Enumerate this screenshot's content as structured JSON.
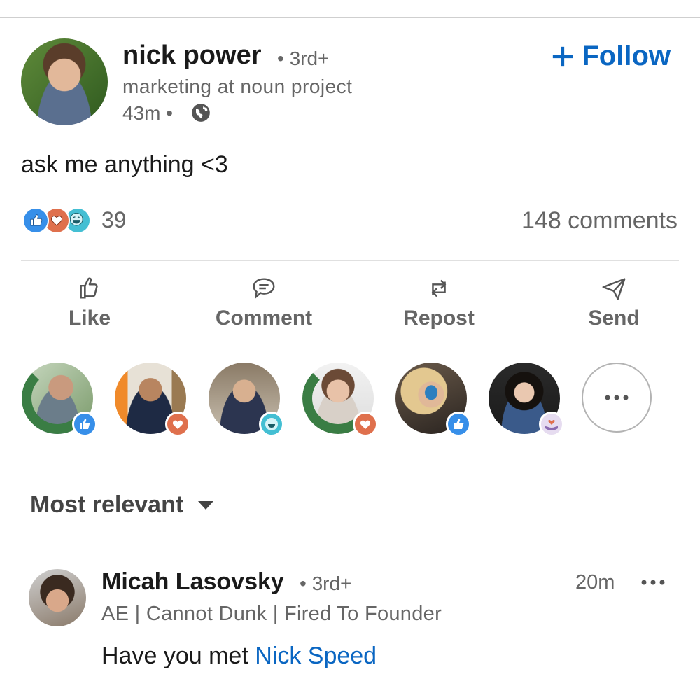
{
  "post": {
    "author_name": "nick power",
    "author_degree": "• 3rd+",
    "author_headline": "marketing at noun project",
    "time": "43m •",
    "follow_label": "Follow",
    "text": "ask me anything <3"
  },
  "social": {
    "reaction_count": "39",
    "comment_count": "148 comments",
    "reaction_icons": [
      "like-icon",
      "love-icon",
      "funny-icon"
    ]
  },
  "actions": {
    "like": "Like",
    "comment": "Comment",
    "repost": "Repost",
    "send": "Send"
  },
  "reactors": [
    {
      "badge": "like-icon",
      "frame": "#OPENTOWORK"
    },
    {
      "badge": "love-icon"
    },
    {
      "badge": "funny-icon"
    },
    {
      "badge": "love-icon",
      "frame": "#OPENTOWORK"
    },
    {
      "badge": "like-icon"
    },
    {
      "badge": "support-icon"
    }
  ],
  "sort": {
    "label": "Most relevant"
  },
  "comment": {
    "name": "Micah Lasovsky",
    "degree": "• 3rd+",
    "time": "20m",
    "headline": "AE | Cannot Dunk | Fired To Founder",
    "text_prefix": "Have you met ",
    "mention": "Nick Speed"
  },
  "colors": {
    "brand_blue": "#0a66c2",
    "text_secondary": "#666666",
    "like_blue": "#378fe9",
    "love_red": "#df704d",
    "funny_teal": "#44bfd3"
  }
}
